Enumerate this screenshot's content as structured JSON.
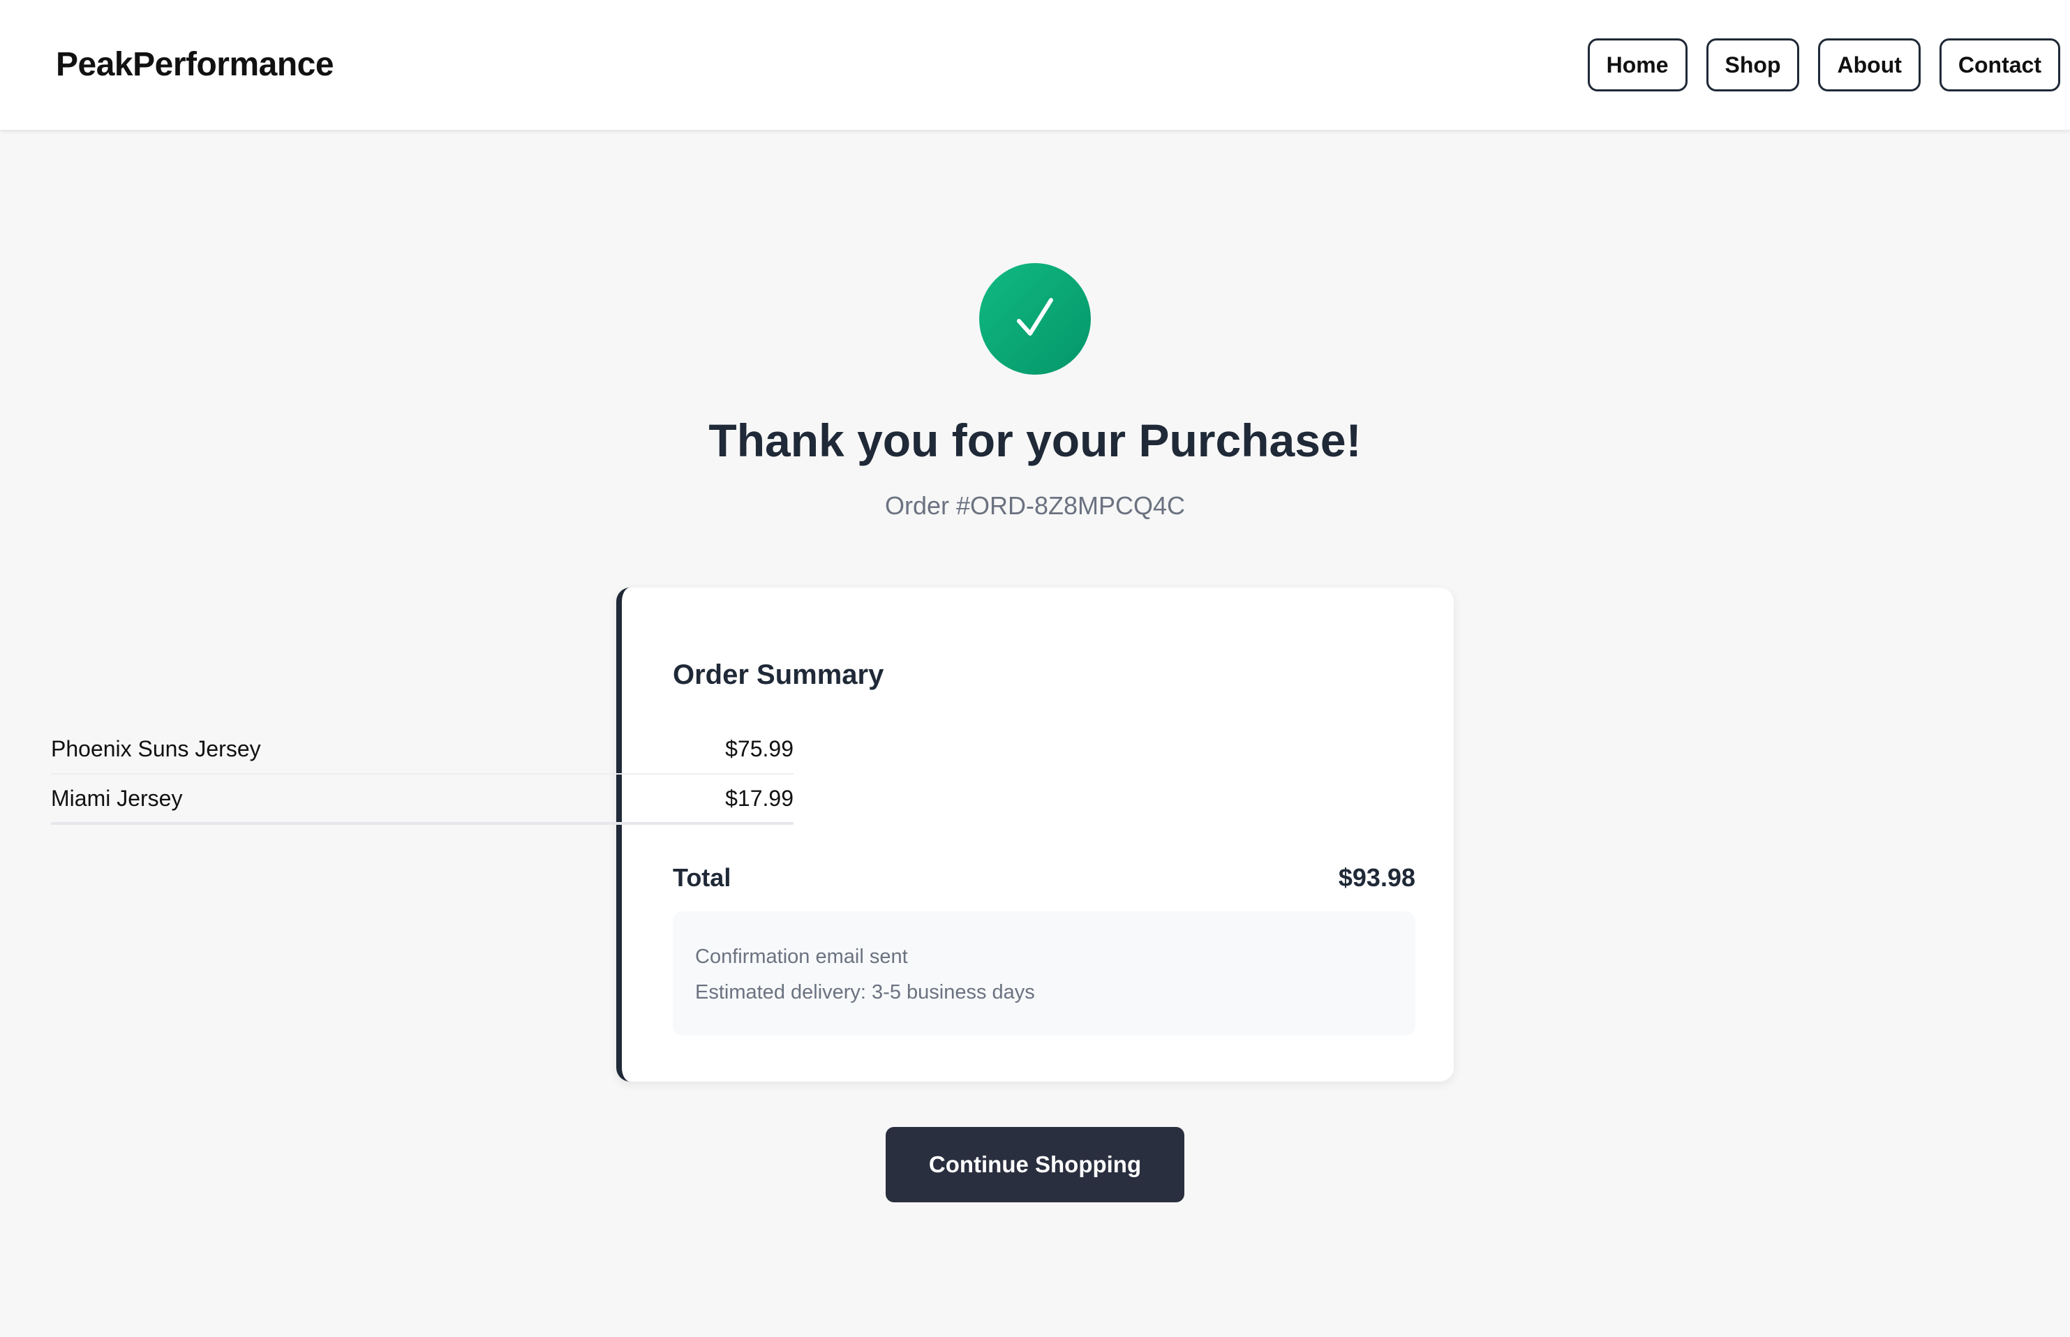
{
  "header": {
    "brand": "PeakPerformance",
    "nav": [
      {
        "label": "Home"
      },
      {
        "label": "Shop"
      },
      {
        "label": "About"
      },
      {
        "label": "Contact"
      }
    ]
  },
  "confirmation": {
    "icon": "checkmark-icon",
    "title": "Thank you for your Purchase!",
    "order_number": "Order #ORD-8Z8MPCQ4C"
  },
  "summary": {
    "title": "Order Summary",
    "items": [
      {
        "name": "Phoenix Suns Jersey",
        "price": "$75.99"
      },
      {
        "name": "Miami Jersey",
        "price": "$17.99"
      }
    ],
    "total_label": "Total",
    "total_value": "$93.98",
    "notes": [
      "Confirmation email sent",
      "Estimated delivery: 3-5 business days"
    ]
  },
  "actions": {
    "continue_label": "Continue Shopping"
  },
  "colors": {
    "success": "#10b981",
    "primary_dark": "#2a2f3f",
    "accent_border": "#1f2937"
  }
}
